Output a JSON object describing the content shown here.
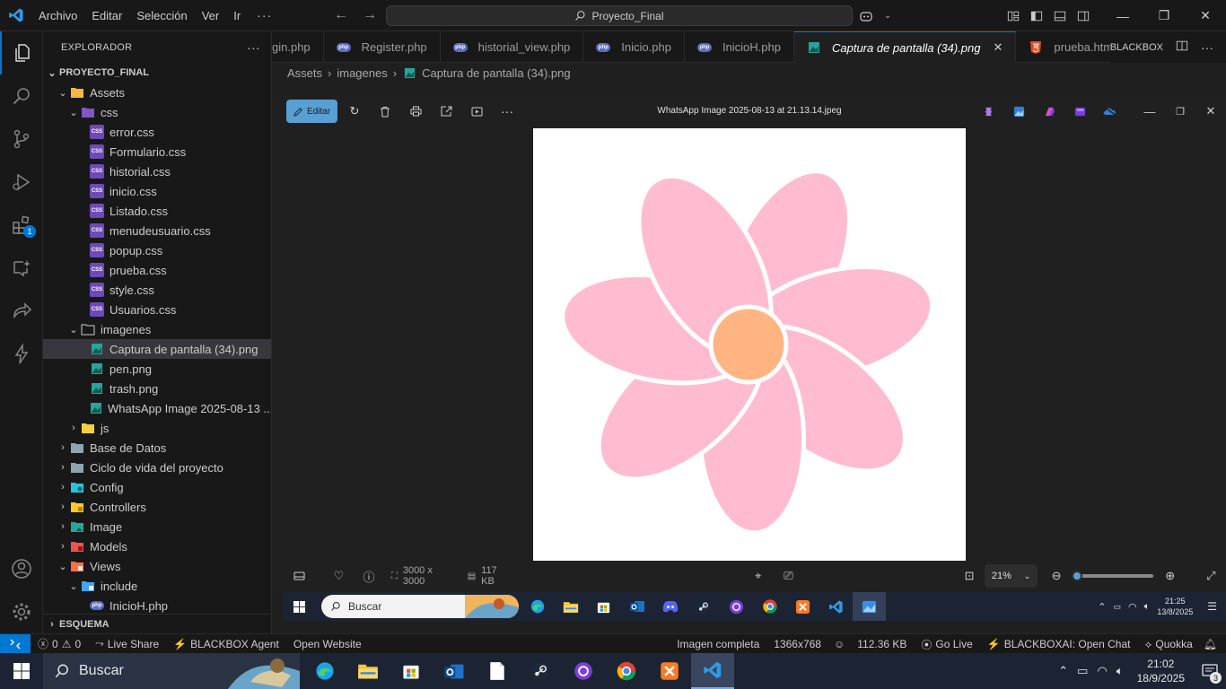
{
  "titlebar": {
    "menu": [
      "Archivo",
      "Editar",
      "Selección",
      "Ver",
      "Ir"
    ],
    "more": "···",
    "command_center": "Proyecto_Final"
  },
  "sidebar": {
    "title": "EXPLORADOR",
    "more": "···",
    "root": "PROYECTO_FINAL",
    "tree": [
      {
        "label": "Assets",
        "kind": "folder-open"
      },
      {
        "label": "css",
        "kind": "folder-open"
      },
      {
        "label": "error.css",
        "kind": "css"
      },
      {
        "label": "Formulario.css",
        "kind": "css"
      },
      {
        "label": "historial.css",
        "kind": "css"
      },
      {
        "label": "inicio.css",
        "kind": "css"
      },
      {
        "label": "Listado.css",
        "kind": "css"
      },
      {
        "label": "menudeusuario.css",
        "kind": "css"
      },
      {
        "label": "popup.css",
        "kind": "css"
      },
      {
        "label": "prueba.css",
        "kind": "css"
      },
      {
        "label": "style.css",
        "kind": "css"
      },
      {
        "label": "Usuarios.css",
        "kind": "css"
      },
      {
        "label": "imagenes",
        "kind": "folder-open"
      },
      {
        "label": "Captura de pantalla (34).png",
        "kind": "img"
      },
      {
        "label": "pen.png",
        "kind": "img"
      },
      {
        "label": "trash.png",
        "kind": "img"
      },
      {
        "label": "WhatsApp Image 2025-08-13 ...",
        "kind": "img"
      },
      {
        "label": "js",
        "kind": "folder"
      },
      {
        "label": "Base de Datos",
        "kind": "folder"
      },
      {
        "label": "Ciclo de vida del proyecto",
        "kind": "folder"
      },
      {
        "label": "Config",
        "kind": "folder"
      },
      {
        "label": "Controllers",
        "kind": "folder"
      },
      {
        "label": "Image",
        "kind": "folder"
      },
      {
        "label": "Models",
        "kind": "folder"
      },
      {
        "label": "Views",
        "kind": "folder-open"
      },
      {
        "label": "include",
        "kind": "folder-open"
      },
      {
        "label": "InicioH.php",
        "kind": "php"
      }
    ],
    "outline": "ESQUEMA",
    "extensions_badge": "1"
  },
  "tabs": [
    {
      "label": "gin.php"
    },
    {
      "label": "Register.php"
    },
    {
      "label": "historial_view.php"
    },
    {
      "label": "Inicio.php"
    },
    {
      "label": "InicioH.php"
    },
    {
      "label": "Captura de pantalla (34).png",
      "active": true
    },
    {
      "label": "prueba.htm"
    }
  ],
  "tabs_right": {
    "blackbox": "BLACKBOX",
    "more": "···"
  },
  "breadcrumb": [
    "Assets",
    "imagenes",
    "Captura de pantalla (34).png"
  ],
  "viewer": {
    "edit_label": "Editar",
    "title": "WhatsApp Image 2025-08-13 at 21.13.14.jpeg",
    "dimensions": "3000 x 3000",
    "size": "117 KB",
    "zoom": "21%",
    "zoom_fraction": 0.0
  },
  "inner_taskbar": {
    "search": "Buscar",
    "time": "21:25",
    "date": "13/8/2025"
  },
  "statusbar": {
    "errors": "0",
    "warnings": "0",
    "live_share": "Live Share",
    "blackbox_agent": "BLACKBOX Agent",
    "open_website": "Open Website",
    "image_mode": "Imagen completa",
    "resolution": "1366x768",
    "file_size": "112.36 KB",
    "go_live": "Go Live",
    "blackboxai": "BLACKBOXAI: Open Chat",
    "quokka": "Quokka"
  },
  "taskbar": {
    "search": "Buscar",
    "time": "21:02",
    "date": "18/9/2025",
    "notifications": "3"
  },
  "colors": {
    "accent": "#0078d4",
    "petal": "#ffbcd0",
    "center": "#ffb482"
  }
}
